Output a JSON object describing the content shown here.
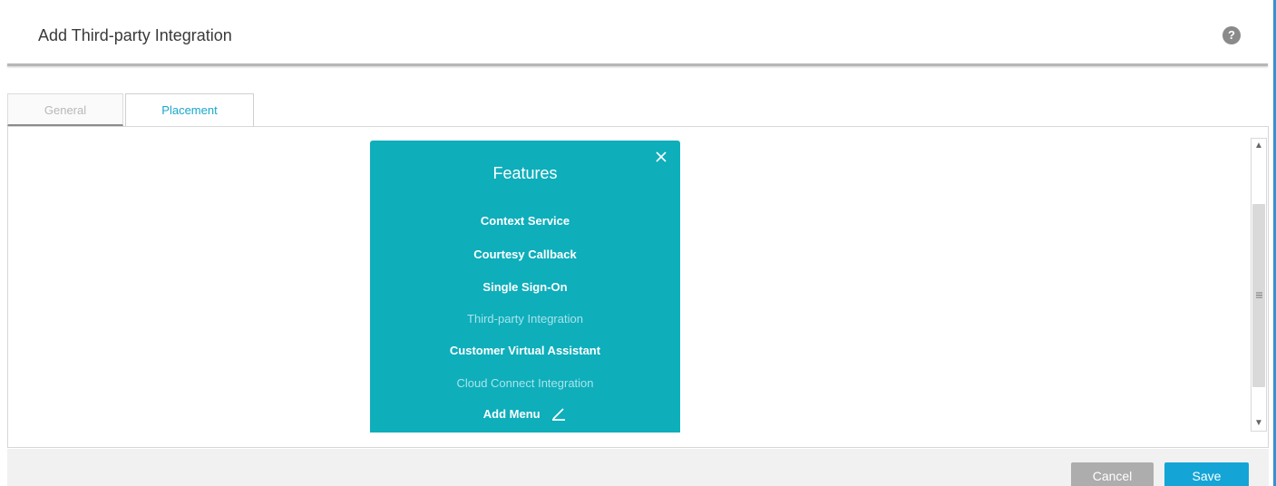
{
  "header": {
    "title": "Add Third-party Integration",
    "help_icon": "?"
  },
  "tabs": [
    {
      "label": "General",
      "active": false
    },
    {
      "label": "Placement",
      "active": true
    }
  ],
  "features_menu": {
    "title": "Features",
    "close_icon": "close-icon",
    "items": [
      {
        "label": "Context Service",
        "muted": false
      },
      {
        "label": "Courtesy Callback",
        "muted": false
      },
      {
        "label": "Single Sign-On",
        "muted": false
      },
      {
        "label": "Third-party Integration",
        "muted": true
      },
      {
        "label": "Customer Virtual Assistant",
        "muted": false
      },
      {
        "label": "Cloud Connect Integration",
        "muted": true
      }
    ],
    "add_menu_label": "Add Menu",
    "add_menu_icon": "pencil-icon",
    "background_color": "#0eaebb"
  },
  "footer": {
    "cancel_label": "Cancel",
    "save_label": "Save",
    "save_color": "#14a5d6",
    "cancel_color": "#adadad"
  },
  "colors": {
    "active_tab_text": "#17a8cc",
    "accent_edge": "#3a8fd0"
  }
}
